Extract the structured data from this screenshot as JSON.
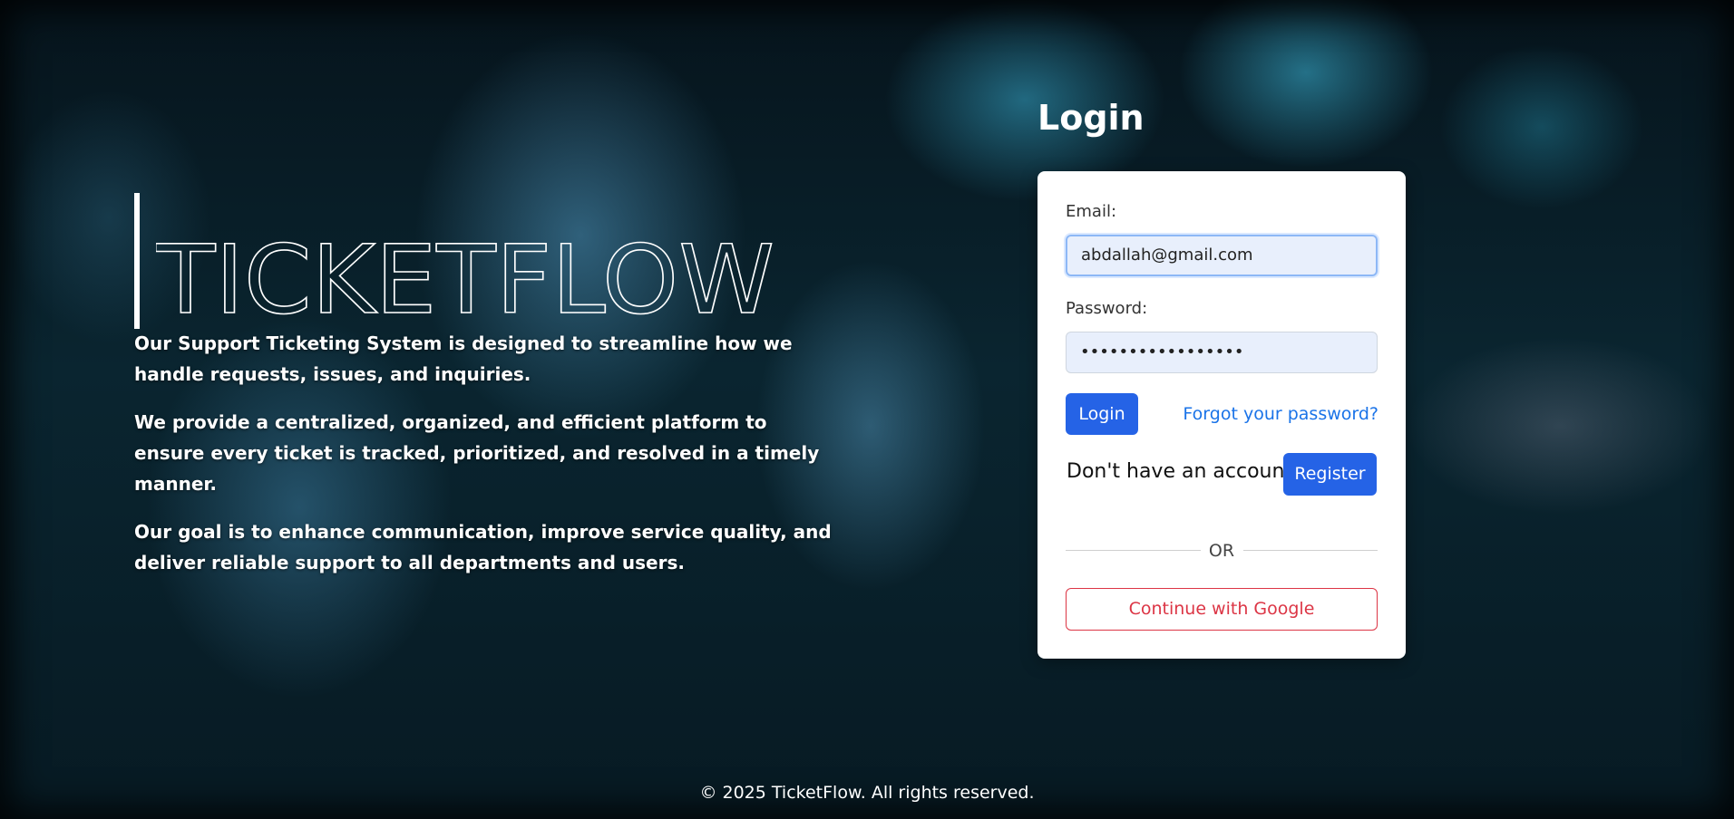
{
  "brand": {
    "logo_text": "TICKETFLOW"
  },
  "hero": {
    "paragraphs": [
      "Our Support Ticketing System is designed to streamline how we handle requests, issues, and inquiries.",
      "We provide a centralized, organized, and efficient platform to ensure every ticket is tracked, prioritized, and resolved in a timely manner.",
      "Our goal is to enhance communication, improve service quality, and deliver reliable support to all departments and users."
    ]
  },
  "login": {
    "title": "Login",
    "email_label": "Email:",
    "email_value": "abdallah@gmail.com",
    "password_label": "Password:",
    "password_value": "•••••••••••••••••",
    "login_button": "Login",
    "forgot_link": "Forgot your password?",
    "no_account_text": "Don't have an account?",
    "register_button": "Register",
    "divider_text": "OR",
    "google_button": "Continue with Google"
  },
  "footer": {
    "copyright": "© 2025 TicketFlow. All rights reserved."
  },
  "colors": {
    "primary": "#2563e6",
    "link": "#1a73e8",
    "google_red": "#dc3545",
    "input_bg": "#e8effc"
  }
}
